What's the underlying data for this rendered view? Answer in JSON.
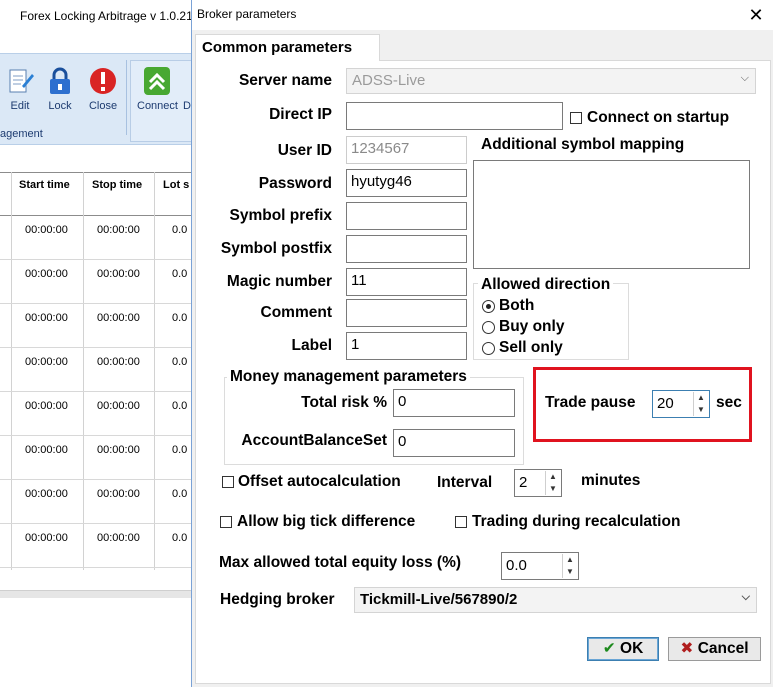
{
  "app": {
    "title": "Forex Locking Arbitrage v 1.0.21",
    "ribbon": {
      "buttons": [
        {
          "label": "Edit",
          "icon": "pencil-document-icon"
        },
        {
          "label": "Lock",
          "icon": "padlock-icon"
        },
        {
          "label": "Close",
          "icon": "red-stop-icon"
        },
        {
          "label": "Connect",
          "icon": "green-double-chevron-icon"
        },
        {
          "label": "D",
          "icon": "partial-icon"
        }
      ],
      "group_label": "agement"
    },
    "grid": {
      "columns": [
        "Start time",
        "Stop time",
        "Lot s"
      ],
      "rows": [
        [
          "00:00:00",
          "00:00:00",
          "0.0"
        ],
        [
          "00:00:00",
          "00:00:00",
          "0.0"
        ],
        [
          "00:00:00",
          "00:00:00",
          "0.0"
        ],
        [
          "00:00:00",
          "00:00:00",
          "0.0"
        ],
        [
          "00:00:00",
          "00:00:00",
          "0.0"
        ],
        [
          "00:00:00",
          "00:00:00",
          "0.0"
        ],
        [
          "00:00:00",
          "00:00:00",
          "0.0"
        ],
        [
          "00:00:00",
          "00:00:00",
          "0.0"
        ]
      ]
    }
  },
  "dialog": {
    "title": "Broker parameters",
    "close_glyph": "✕",
    "tab": "Common parameters",
    "fields": {
      "server_name": {
        "label": "Server name",
        "value": "ADSS-Live"
      },
      "direct_ip": {
        "label": "Direct IP",
        "value": ""
      },
      "user_id": {
        "label": "User ID",
        "value": "1234567"
      },
      "password": {
        "label": "Password",
        "value": "hyutyg46"
      },
      "symbol_prefix": {
        "label": "Symbol prefix",
        "value": ""
      },
      "symbol_postfix": {
        "label": "Symbol postfix",
        "value": ""
      },
      "magic_number": {
        "label": "Magic number",
        "value": "11"
      },
      "comment": {
        "label": "Comment",
        "value": ""
      },
      "label": {
        "label": "Label",
        "value": "1"
      }
    },
    "connect_on_startup": {
      "label": "Connect on startup",
      "checked": false
    },
    "additional_symbol_mapping": {
      "label": "Additional symbol mapping",
      "value": ""
    },
    "allowed_direction": {
      "title": "Allowed direction",
      "options": [
        {
          "label": "Both",
          "selected": true
        },
        {
          "label": "Buy only",
          "selected": false
        },
        {
          "label": "Sell only",
          "selected": false
        }
      ]
    },
    "money_management": {
      "title": "Money management parameters",
      "total_risk": {
        "label": "Total risk %",
        "value": "0"
      },
      "account_balance_set": {
        "label": "AccountBalanceSet",
        "value": "0"
      }
    },
    "trade_pause": {
      "label": "Trade pause",
      "value": "20",
      "unit": "sec"
    },
    "offset_autocalculation": {
      "label": "Offset autocalculation",
      "checked": false
    },
    "interval": {
      "label": "Interval",
      "value": "2",
      "unit": "minutes"
    },
    "allow_big_tick_difference": {
      "label": "Allow big tick difference",
      "checked": false
    },
    "trading_during_recalculation": {
      "label": "Trading during recalculation",
      "checked": false
    },
    "max_equity_loss": {
      "label": "Max allowed total equity loss (%)",
      "value": "0.0"
    },
    "hedging_broker": {
      "label": "Hedging broker",
      "value": "Tickmill-Live/567890/2"
    },
    "buttons": {
      "ok": "OK",
      "cancel": "Cancel"
    },
    "colors": {
      "highlight": "#e0131f",
      "ok_check": "#1e8a1e",
      "cancel_x": "#b01e1e"
    }
  }
}
